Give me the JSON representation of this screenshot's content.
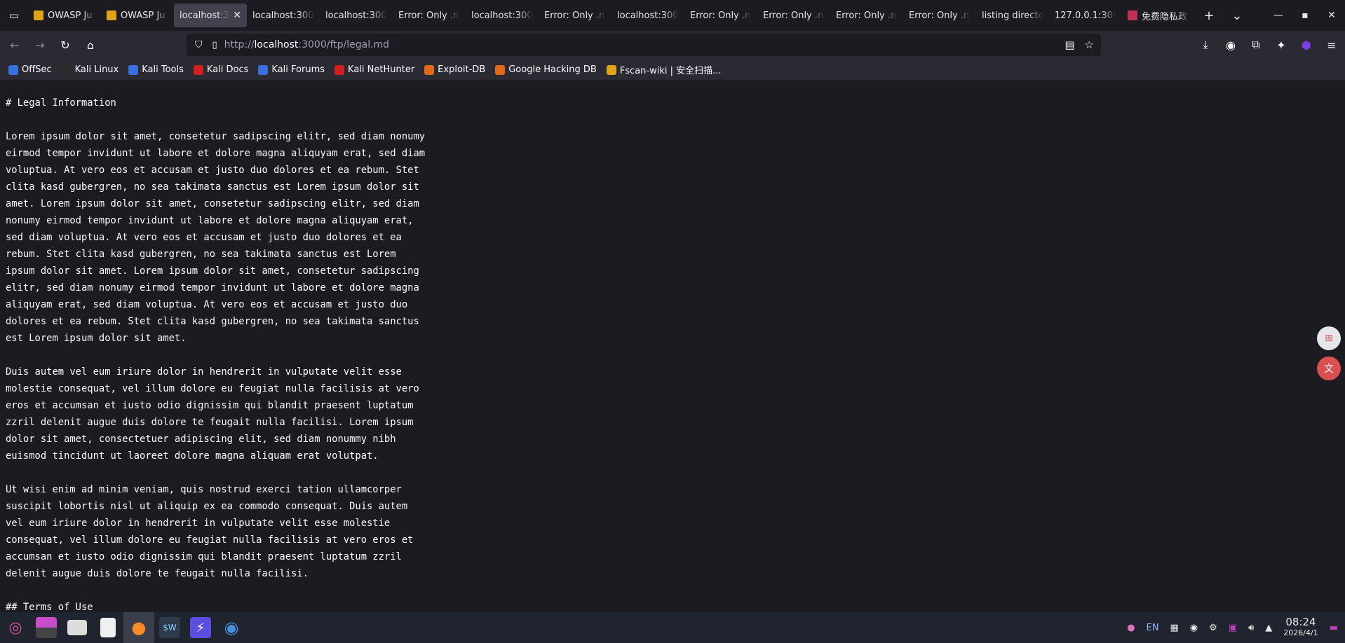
{
  "tabs": [
    {
      "label": "OWASP Ju",
      "icon": "juice-shop-icon",
      "color": "#e0a419",
      "active": false
    },
    {
      "label": "OWASP Ju",
      "icon": "juice-shop-icon",
      "color": "#e0a419",
      "active": false
    },
    {
      "label": "localhost:3",
      "icon": "",
      "color": "",
      "active": true
    },
    {
      "label": "localhost:300",
      "icon": "",
      "color": "",
      "active": false
    },
    {
      "label": "localhost:300",
      "icon": "",
      "color": "",
      "active": false
    },
    {
      "label": "Error: Only .n",
      "icon": "",
      "color": "",
      "active": false
    },
    {
      "label": "localhost:300",
      "icon": "",
      "color": "",
      "active": false
    },
    {
      "label": "Error: Only .n",
      "icon": "",
      "color": "",
      "active": false
    },
    {
      "label": "localhost:300",
      "icon": "",
      "color": "",
      "active": false
    },
    {
      "label": "Error: Only .n",
      "icon": "",
      "color": "",
      "active": false
    },
    {
      "label": "Error: Only .n",
      "icon": "",
      "color": "",
      "active": false
    },
    {
      "label": "Error: Only .n",
      "icon": "",
      "color": "",
      "active": false
    },
    {
      "label": "Error: Only .n",
      "icon": "",
      "color": "",
      "active": false
    },
    {
      "label": "listing directo",
      "icon": "",
      "color": "",
      "active": false
    },
    {
      "label": "127.0.0.1:300",
      "icon": "",
      "color": "",
      "active": false
    },
    {
      "label": "免费隐私政",
      "icon": "privacy-icon",
      "color": "#c0305a",
      "active": false
    }
  ],
  "url": {
    "prefix": "http://",
    "host": "localhost",
    "rest": ":3000/ftp/legal.md"
  },
  "bookmarks": [
    {
      "label": "OffSec",
      "color": "#3a6fe0"
    },
    {
      "label": "Kali Linux",
      "color": "#2a2a2a"
    },
    {
      "label": "Kali Tools",
      "color": "#3a6fe0"
    },
    {
      "label": "Kali Docs",
      "color": "#d02020"
    },
    {
      "label": "Kali Forums",
      "color": "#3a6fe0"
    },
    {
      "label": "Kali NetHunter",
      "color": "#d02020"
    },
    {
      "label": "Exploit-DB",
      "color": "#e06a1a"
    },
    {
      "label": "Google Hacking DB",
      "color": "#e06a1a"
    },
    {
      "label": "Fscan-wiki | 安全扫描...",
      "color": "#e0a419"
    }
  ],
  "document_text": "# Legal Information\n\nLorem ipsum dolor sit amet, consetetur sadipscing elitr, sed diam nonumy\neirmod tempor invidunt ut labore et dolore magna aliquyam erat, sed diam\nvoluptua. At vero eos et accusam et justo duo dolores et ea rebum. Stet\nclita kasd gubergren, no sea takimata sanctus est Lorem ipsum dolor sit\namet. Lorem ipsum dolor sit amet, consetetur sadipscing elitr, sed diam\nnonumy eirmod tempor invidunt ut labore et dolore magna aliquyam erat,\nsed diam voluptua. At vero eos et accusam et justo duo dolores et ea\nrebum. Stet clita kasd gubergren, no sea takimata sanctus est Lorem\nipsum dolor sit amet. Lorem ipsum dolor sit amet, consetetur sadipscing\nelitr, sed diam nonumy eirmod tempor invidunt ut labore et dolore magna\naliquyam erat, sed diam voluptua. At vero eos et accusam et justo duo\ndolores et ea rebum. Stet clita kasd gubergren, no sea takimata sanctus\nest Lorem ipsum dolor sit amet.\n\nDuis autem vel eum iriure dolor in hendrerit in vulputate velit esse\nmolestie consequat, vel illum dolore eu feugiat nulla facilisis at vero\neros et accumsan et iusto odio dignissim qui blandit praesent luptatum\nzzril delenit augue duis dolore te feugait nulla facilisi. Lorem ipsum\ndolor sit amet, consectetuer adipiscing elit, sed diam nonummy nibh\neuismod tincidunt ut laoreet dolore magna aliquam erat volutpat.\n\nUt wisi enim ad minim veniam, quis nostrud exerci tation ullamcorper\nsuscipit lobortis nisl ut aliquip ex ea commodo consequat. Duis autem\nvel eum iriure dolor in hendrerit in vulputate velit esse molestie\nconsequat, vel illum dolore eu feugiat nulla facilisis at vero eros et\naccumsan et iusto odio dignissim qui blandit praesent luptatum zzril\ndelenit augue duis dolore te feugait nulla facilisi.\n\n## Terms of Use",
  "taskbar": {
    "language": "EN",
    "time": "08:24",
    "date": "2026/4/1"
  },
  "colors": {
    "page_bg": "#1c1b22",
    "toolbar_bg": "#2b2a33",
    "taskbar_bg": "#20242e",
    "text": "#fbfbfe"
  }
}
